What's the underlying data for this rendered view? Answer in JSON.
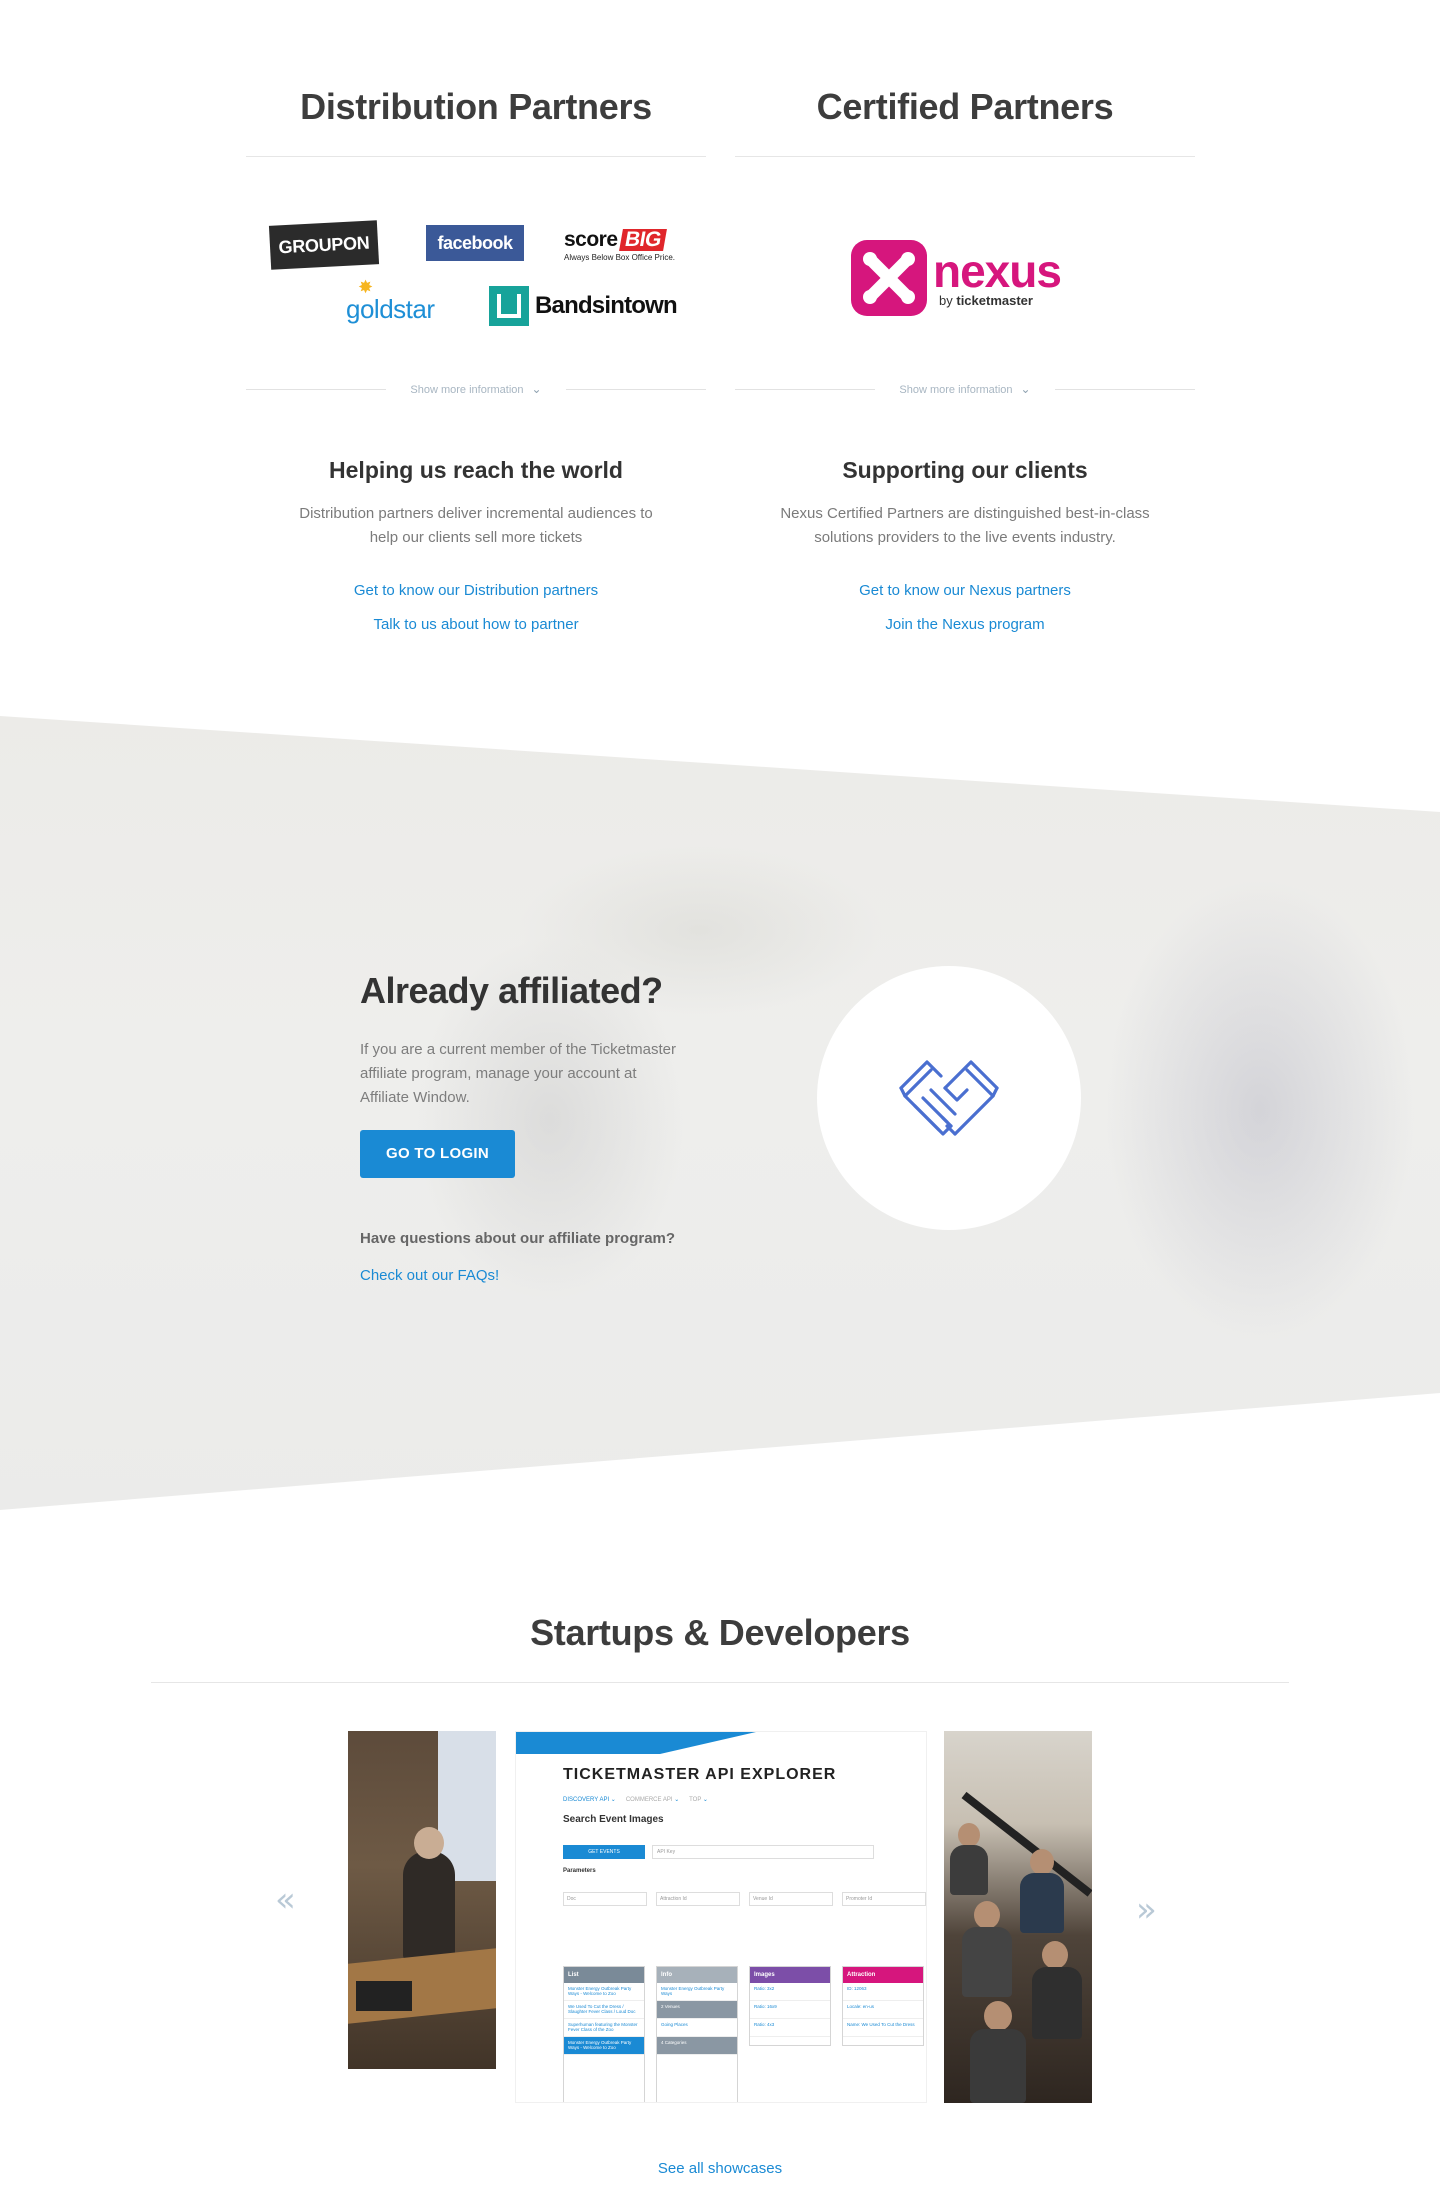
{
  "distribution": {
    "heading": "Distribution Partners",
    "logos": {
      "groupon": "GROUPON",
      "facebook": "facebook",
      "scorebig_score": "score",
      "scorebig_big": "BIG",
      "scorebig_tagline": "Always Below Box Office Price.",
      "goldstar": "goldstar",
      "bandsintown": "Bandsintown"
    },
    "show_more": "Show more information",
    "subheading": "Helping us reach the world",
    "description": "Distribution partners deliver incremental audiences to help our clients sell more tickets",
    "links": [
      "Get to know our Distribution partners",
      "Talk to us about how to partner"
    ]
  },
  "certified": {
    "heading": "Certified Partners",
    "logo": {
      "name": "nexus",
      "by": "by",
      "brand": "ticketmaster"
    },
    "show_more": "Show more information",
    "subheading": "Supporting our clients",
    "description": "Nexus Certified Partners are distinguished best-in-class solutions providers to the live events industry.",
    "links": [
      "Get to know our Nexus partners",
      "Join the Nexus program"
    ]
  },
  "affiliate": {
    "heading": "Already affiliated?",
    "body": "If you are a current member of the Ticketmaster affiliate program, manage your account at Affiliate Window.",
    "button": "GO TO LOGIN",
    "question": "Have questions about our affiliate program?",
    "faq_link": "Check out our FAQs!",
    "icon": "handshake-icon",
    "icon_color": "#4a6fd0"
  },
  "startups": {
    "heading": "Startups & Developers",
    "explorer": {
      "title": "TICKETMASTER API EXPLORER",
      "subnav": [
        "DISCOVERY API",
        "COMMERCE API",
        "TOP"
      ],
      "subtitle": "Search Event Images",
      "button": "GET EVENTS",
      "api_key": "API Key",
      "parameters": "Parameters",
      "fields": [
        "Doc",
        "Attraction Id",
        "Venue Id",
        "Promoter Id"
      ],
      "cards": [
        {
          "title": "List",
          "rows": [
            "Monster Energy Outbreak Party Ways - Welcome to Zoo",
            "We Used To Cut the Dress / Slaughter Fever Class / Loud Doc",
            "Superhuman featuring the Monster Fever Class of the Zoo",
            "Monster Energy Outbreak Party Ways - Welcome to Zoo"
          ]
        },
        {
          "title": "Info",
          "rows": [
            "Monster Energy Outbreak Party Ways",
            "2 Venues",
            "Going Places",
            "4 Categories"
          ]
        },
        {
          "title": "Images",
          "rows": [
            "Ratio: 3x2",
            "Ratio: 16x9",
            "Ratio: 4x3"
          ]
        },
        {
          "title": "Attraction",
          "rows": [
            "ID: 12063",
            "Locale: en-us",
            "Name: We Used To Cut the Dress"
          ]
        }
      ]
    },
    "see_all": "See all showcases"
  },
  "colors": {
    "accent": "#1a8ad4",
    "groupon": "#2b2b2b",
    "facebook": "#3b5998",
    "scorebig_red": "#e0262b",
    "goldstar_blue": "#1e8fd6",
    "bandsintown_teal": "#17a39a",
    "nexus_pink": "#d6167d"
  }
}
